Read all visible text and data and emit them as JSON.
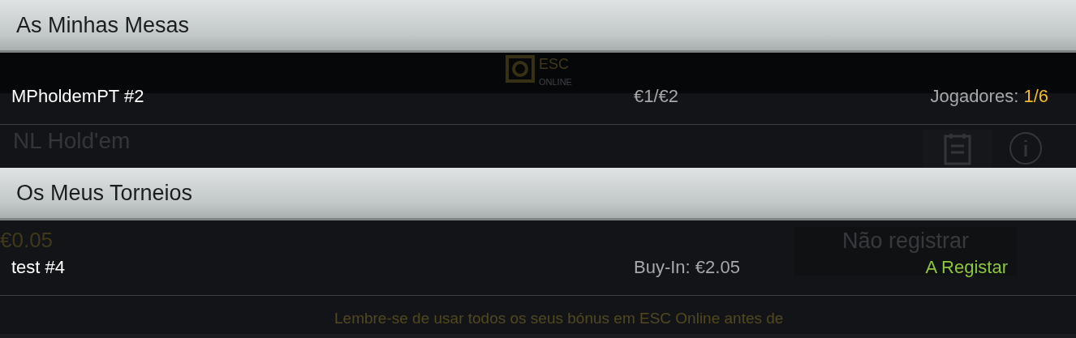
{
  "backdrop": {
    "logo": {
      "name": "ESC",
      "tagline": "ONLINE"
    },
    "game": "NL Hold'em",
    "price": "€0.05",
    "button": "Não registrar",
    "notice": "Lembre-se de usar todos os seus bónus em ESC Online antes de"
  },
  "sections": [
    {
      "title": "As Minhas Mesas",
      "rows": [
        {
          "kind": "table",
          "name": "MPholdemPT #2",
          "stake": "€1/€2",
          "players_label": "Jogadores:",
          "players": "1/6"
        }
      ]
    },
    {
      "title": "Os Meus Torneios",
      "rows": [
        {
          "kind": "tournament",
          "name": "test #4",
          "buy_in": "Buy-In: €2.05",
          "status": "A Registar"
        }
      ]
    }
  ]
}
